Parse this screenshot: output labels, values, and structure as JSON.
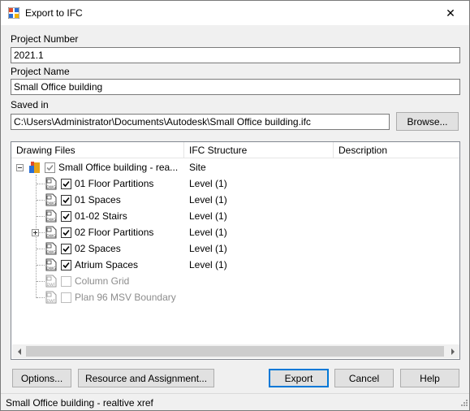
{
  "window": {
    "title": "Export to IFC",
    "close_glyph": "✕"
  },
  "form": {
    "project_number_label": "Project Number",
    "project_number_value": "2021.1",
    "project_name_label": "Project Name",
    "project_name_value": "Small Office building",
    "saved_in_label": "Saved in",
    "saved_in_value": "C:\\Users\\Administrator\\Documents\\Autodesk\\Small Office building.ifc",
    "browse_label": "Browse..."
  },
  "list": {
    "columns": [
      "Drawing Files",
      "IFC Structure",
      "Description"
    ],
    "root": {
      "name": "Small Office building - rea...",
      "structure": "Site",
      "expander": "−"
    },
    "items": [
      {
        "name": "01 Floor Partitions",
        "structure": "Level (1)",
        "checked": true,
        "enabled": true,
        "expander": "",
        "icon": "dwg-file-icon"
      },
      {
        "name": "01 Spaces",
        "structure": "Level (1)",
        "checked": true,
        "enabled": true,
        "expander": "",
        "icon": "dwg-file-icon"
      },
      {
        "name": "01-02 Stairs",
        "structure": "Level (1)",
        "checked": true,
        "enabled": true,
        "expander": "",
        "icon": "dwg-file-icon"
      },
      {
        "name": "02 Floor Partitions",
        "structure": "Level (1)",
        "checked": true,
        "enabled": true,
        "expander": "+",
        "icon": "dwg-file-icon"
      },
      {
        "name": "02 Spaces",
        "structure": "Level (1)",
        "checked": true,
        "enabled": true,
        "expander": "",
        "icon": "dwg-file-icon"
      },
      {
        "name": "Atrium Spaces",
        "structure": "Level (1)",
        "checked": true,
        "enabled": true,
        "expander": "",
        "icon": "dwg-file-icon"
      },
      {
        "name": "Column Grid",
        "structure": "",
        "checked": false,
        "enabled": false,
        "expander": "",
        "icon": "dwf-file-icon"
      },
      {
        "name": "Plan 96 MSV Boundary",
        "structure": "",
        "checked": false,
        "enabled": false,
        "expander": "",
        "icon": "dwf-file-icon"
      }
    ]
  },
  "buttons": {
    "options": "Options...",
    "resource": "Resource and Assignment...",
    "export": "Export",
    "cancel": "Cancel",
    "help": "Help"
  },
  "status": {
    "text": "Small Office building - realtive xref"
  },
  "icon_labels": {
    "dwg": "DWG",
    "dwf": "DWF"
  }
}
